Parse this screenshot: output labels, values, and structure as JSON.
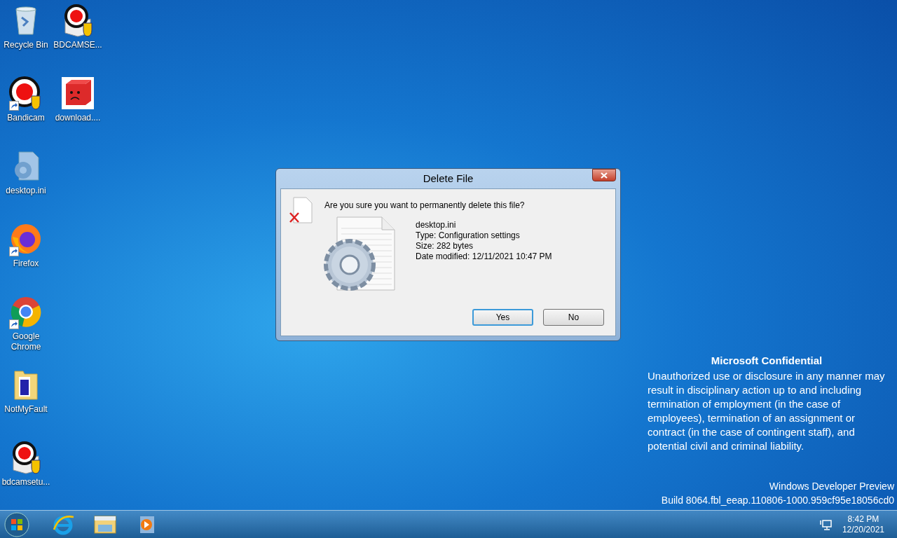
{
  "desktop_columns": [
    [
      {
        "label": "Recycle Bin",
        "kind": "bin",
        "shortcut": false
      },
      {
        "label": "Bandicam",
        "kind": "record",
        "shortcut": true
      },
      {
        "label": "desktop.ini",
        "kind": "config",
        "shortcut": false
      },
      {
        "label": "Firefox",
        "kind": "firefox",
        "shortcut": true
      },
      {
        "label": "Google Chrome",
        "kind": "chrome",
        "shortcut": true
      },
      {
        "label": "NotMyFault",
        "kind": "folder",
        "shortcut": false
      },
      {
        "label": "bdcamsetu...",
        "kind": "installer",
        "shortcut": false
      }
    ],
    [
      {
        "label": "BDCAMSE...",
        "kind": "installer",
        "shortcut": false
      },
      {
        "label": "download....",
        "kind": "cube",
        "shortcut": false
      }
    ]
  ],
  "dialog": {
    "title": "Delete File",
    "question": "Are you sure you want to permanently delete this file?",
    "file_name": "desktop.ini",
    "details": [
      "Type: Configuration settings",
      "Size: 282 bytes",
      "Date modified: 12/11/2021 10:47 PM"
    ],
    "buttons": [
      {
        "label": "Yes",
        "selected": true
      },
      {
        "label": "No",
        "selected": false
      }
    ]
  },
  "watermark_notice": {
    "title": "Microsoft Confidential",
    "body": "Unauthorized use or disclosure in any manner may result in disciplinary action up to and including termination of employment (in the case of employees), termination of an assignment or contract (in the case of contingent staff), and potential civil and criminal liability."
  },
  "build_info": [
    "Windows Developer Preview",
    "Build 8064.fbl_eeap.110806-1000.959cf95e18056cd0"
  ],
  "taskbar": {
    "apps": [
      {
        "kind": "browser"
      },
      {
        "kind": "explorer"
      },
      {
        "kind": "media"
      }
    ],
    "time": "8:42 PM",
    "date": "12/20/2021"
  }
}
